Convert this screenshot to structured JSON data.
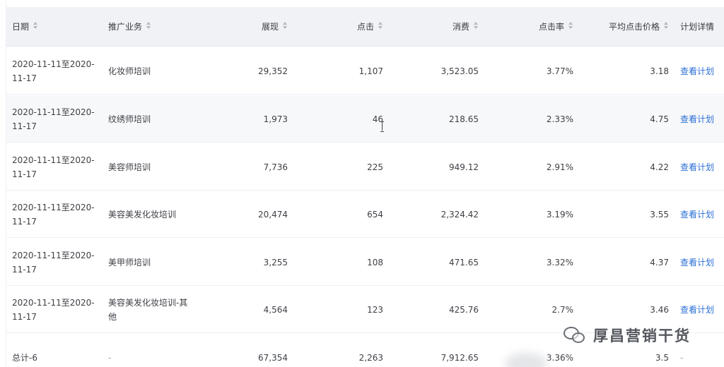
{
  "table": {
    "headers": {
      "date": "日期",
      "business": "推广业务",
      "impressions": "展现",
      "clicks": "点击",
      "cost": "消费",
      "ctr": "点击率",
      "avg_cpc": "平均点击价格",
      "plan": "计划详情"
    },
    "rows": [
      {
        "date": "2020-11-11至2020-11-17",
        "business": "化妆师培训",
        "impressions": "29,352",
        "clicks": "1,107",
        "cost": "3,523.05",
        "ctr": "3.77%",
        "avg_cpc": "3.18",
        "plan_link": "查看计划"
      },
      {
        "date": "2020-11-11至2020-11-17",
        "business": "纹绣师培训",
        "impressions": "1,973",
        "clicks": "46",
        "cost": "218.65",
        "ctr": "2.33%",
        "avg_cpc": "4.75",
        "plan_link": "查看计划"
      },
      {
        "date": "2020-11-11至2020-11-17",
        "business": "美容师培训",
        "impressions": "7,736",
        "clicks": "225",
        "cost": "949.12",
        "ctr": "2.91%",
        "avg_cpc": "4.22",
        "plan_link": "查看计划"
      },
      {
        "date": "2020-11-11至2020-11-17",
        "business": "美容美发化妆培训",
        "impressions": "20,474",
        "clicks": "654",
        "cost": "2,324.42",
        "ctr": "3.19%",
        "avg_cpc": "3.55",
        "plan_link": "查看计划"
      },
      {
        "date": "2020-11-11至2020-11-17",
        "business": "美甲师培训",
        "impressions": "3,255",
        "clicks": "108",
        "cost": "471.65",
        "ctr": "3.32%",
        "avg_cpc": "4.37",
        "plan_link": "查看计划"
      },
      {
        "date": "2020-11-11至2020-11-17",
        "business": "美容美发化妆培训-其他",
        "impressions": "4,564",
        "clicks": "123",
        "cost": "425.76",
        "ctr": "2.7%",
        "avg_cpc": "3.46",
        "plan_link": "查看计划"
      }
    ],
    "total": {
      "label": "总计-6",
      "business": "-",
      "impressions": "67,354",
      "clicks": "2,263",
      "cost": "7,912.65",
      "ctr": "3.36%",
      "avg_cpc": "3.5",
      "plan": "-"
    }
  },
  "watermark": {
    "text": "厚昌营销干货",
    "icon": "wechat-icon"
  },
  "colors": {
    "header_bg": "#f1f2f6",
    "link": "#2b6fd6",
    "alt_row_bg": "#f7f8fa"
  }
}
